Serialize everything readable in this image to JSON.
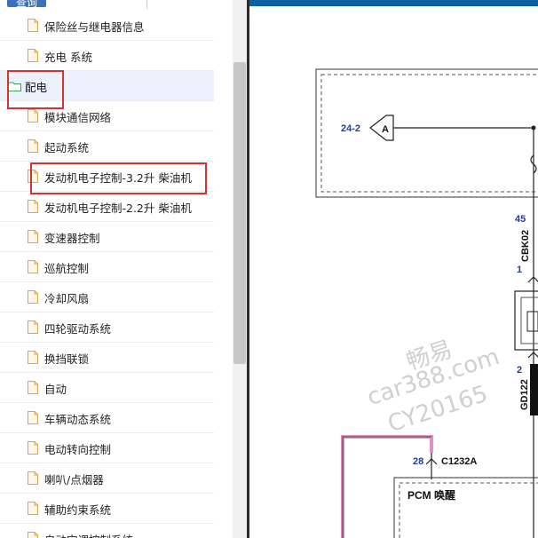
{
  "header": {
    "query_label": "查询"
  },
  "tree": {
    "items": [
      {
        "label": "保险丝与继电器信息",
        "type": "file"
      },
      {
        "label": "充电 系统",
        "type": "file"
      },
      {
        "label": "配电",
        "type": "folder",
        "selected": true
      },
      {
        "label": "模块通信网络",
        "type": "file"
      },
      {
        "label": "起动系统",
        "type": "file"
      },
      {
        "label": "发动机电子控制-3.2升 柴油机",
        "type": "file"
      },
      {
        "label": "发动机电子控制-2.2升 柴油机",
        "type": "file"
      },
      {
        "label": "变速器控制",
        "type": "file"
      },
      {
        "label": "巡航控制",
        "type": "file"
      },
      {
        "label": "冷却风扇",
        "type": "file"
      },
      {
        "label": "四轮驱动系统",
        "type": "file"
      },
      {
        "label": "换挡联锁",
        "type": "file"
      },
      {
        "label": "自动",
        "type": "file"
      },
      {
        "label": "车辆动态系统",
        "type": "file"
      },
      {
        "label": "电动转向控制",
        "type": "file"
      },
      {
        "label": "喇叭/点烟器",
        "type": "file"
      },
      {
        "label": "辅助约束系统",
        "type": "file"
      },
      {
        "label": "自动空调控制系统",
        "type": "file"
      }
    ]
  },
  "diagram": {
    "ref_label": "24-2",
    "connector_letter": "A",
    "pin_top": "45",
    "connector_top": "CBK02",
    "pin_mid": "1",
    "pin_low": "2",
    "connector_low": "GD122",
    "pin_pcm": "28",
    "connector_pcm": "C1232A",
    "module_label": "PCM 唤醒"
  },
  "watermark": {
    "line1": "畅易",
    "line2": "car388.com",
    "line3": "CY20165"
  },
  "colors": {
    "accent_blue": "#3a73b8",
    "highlight_red": "#d93030",
    "wire_pink": "#e58fc0",
    "diagram_blue": "#1f3f9a"
  }
}
